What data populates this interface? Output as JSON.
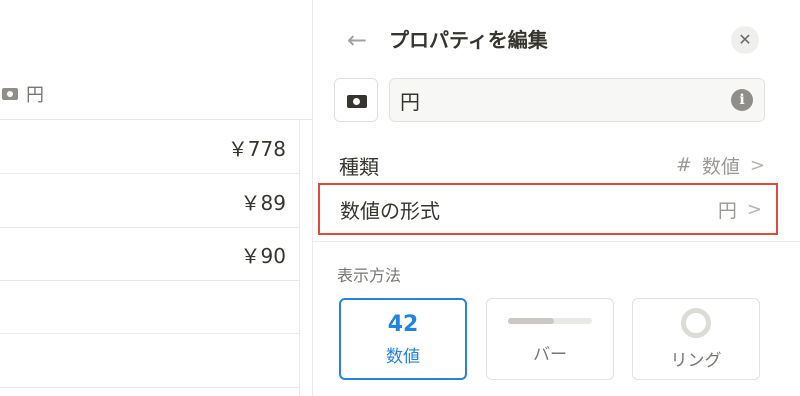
{
  "table": {
    "column_label": "円",
    "column_icon": "money-icon",
    "rows": [
      {
        "value": "￥778"
      },
      {
        "value": "￥89"
      },
      {
        "value": "￥90"
      },
      {
        "value": ""
      },
      {
        "value": ""
      }
    ]
  },
  "panel": {
    "back_icon": "←",
    "title": "プロパティを編集",
    "close_icon": "✕",
    "property_icon": "money-icon",
    "name_value": "円",
    "info_icon": "i",
    "type_row": {
      "label": "種類",
      "hash": "#",
      "value": "数値",
      "chevron": ">"
    },
    "format_row": {
      "label": "数値の形式",
      "value": "円",
      "chevron": ">"
    },
    "display_section_label": "表示方法",
    "display_options": {
      "number": {
        "big": "42",
        "label": "数値",
        "selected": true
      },
      "bar": {
        "label": "バー",
        "fill": 0.55
      },
      "ring": {
        "label": "リング"
      }
    }
  },
  "colors": {
    "accent": "#2383e2",
    "highlight_border": "#e5493a"
  }
}
